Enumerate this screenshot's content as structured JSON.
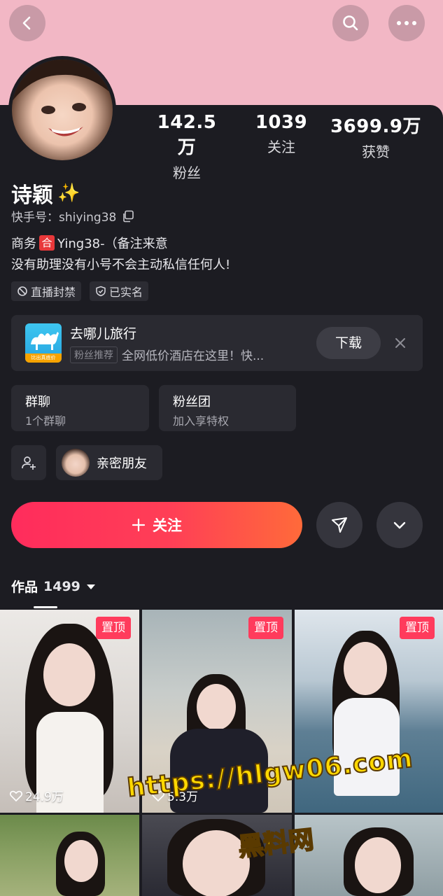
{
  "profile": {
    "name": "诗颖",
    "name_decoration": "✨",
    "kuaishou_id": "快手号：shiying38",
    "bio_prefix": "商务",
    "bio_badge": "合",
    "bio_contact": "Ying38-（备注来意",
    "bio_line2": "没有助理没有小号不会主动私信任何人!"
  },
  "stats": [
    {
      "value": "142.5万",
      "label": "粉丝"
    },
    {
      "value": "1039",
      "label": "关注"
    },
    {
      "value": "3699.9万",
      "label": "获赞"
    }
  ],
  "tags": [
    {
      "icon": "ban-icon",
      "label": "直播封禁"
    },
    {
      "icon": "shield-check-icon",
      "label": "已实名"
    }
  ],
  "ad": {
    "app_name": "去哪儿旅行",
    "logo_strip": "比出真底价",
    "chip": "粉丝推荐",
    "desc": "全网低价酒店在这里！快...",
    "download_label": "下载"
  },
  "cards": [
    {
      "title": "群聊",
      "sub": "1个群聊"
    },
    {
      "title": "粉丝团",
      "sub": "加入享特权"
    }
  ],
  "friend": {
    "label": "亲密朋友"
  },
  "actions": {
    "follow_label": "关注"
  },
  "works": {
    "label": "作品",
    "count": "1499"
  },
  "grid": [
    {
      "pin": "置顶",
      "likes": "24.9万"
    },
    {
      "pin": "置顶",
      "likes": "5.3万"
    },
    {
      "pin": "置顶",
      "likes": ""
    }
  ],
  "watermark": {
    "url": "https://hlgw06.com",
    "name": "黑料网"
  },
  "colors": {
    "header_pink": "#f2b7c5",
    "sheet_bg": "#1c1c22",
    "accent_red": "#ff2c5c",
    "accent_orange": "#ff6a3a"
  }
}
